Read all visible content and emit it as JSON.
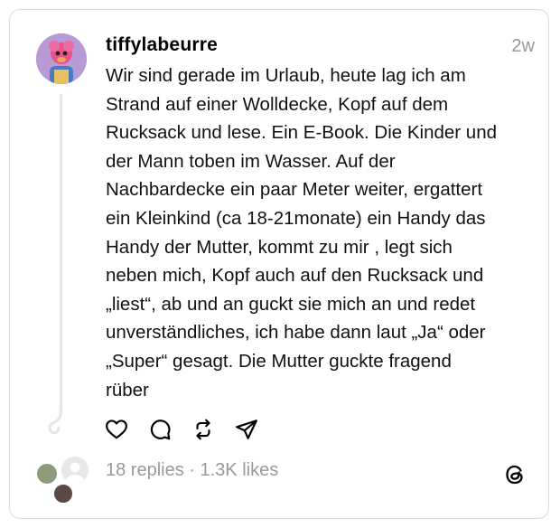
{
  "post": {
    "username": "tiffylabeurre",
    "time": "2w",
    "text": "Wir sind gerade im Urlaub, heute lag ich am\nStrand auf einer Wolldecke, Kopf auf dem\nRucksack und lese. Ein E-Book. Die Kinder und\nder Mann toben im Wasser. Auf der\nNachbardecke ein paar Meter weiter, ergattert\nein Kleinkind (ca 18-21monate) ein Handy das\nHandy der Mutter, kommt zu mir , legt sich\nneben mich, Kopf auch auf den Rucksack und\n„liest“, ab und an guckt sie mich an und redet\nunverständliches, ich habe dann laut „Ja“ oder\n„Super“ gesagt. Die Mutter guckte fragend\nrüber"
  },
  "actions": [
    {
      "icon": "heart-icon"
    },
    {
      "icon": "comment-icon"
    },
    {
      "icon": "repost-icon"
    },
    {
      "icon": "share-icon"
    }
  ],
  "footer": {
    "stats": "18 replies · 1.3K likes",
    "logo_icon": "threads-logo-icon"
  },
  "colors": {
    "muted": "#999999",
    "border": "#dcdcdc",
    "thread_line": "#e6e6e6"
  }
}
